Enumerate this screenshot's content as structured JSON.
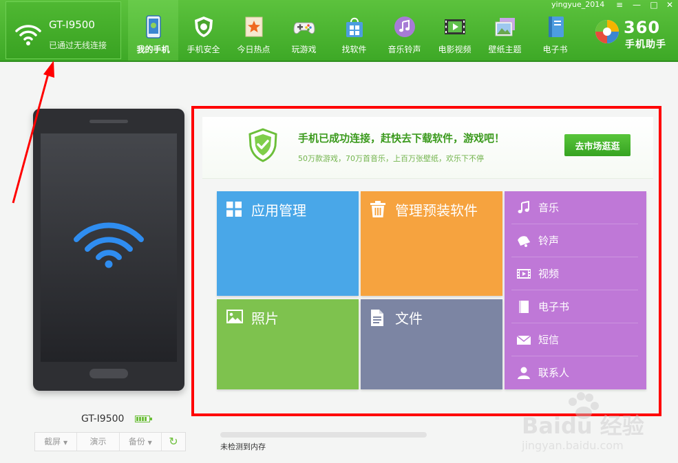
{
  "window": {
    "username": "yingyue_2014",
    "menu_glyph": "≡",
    "minimize_glyph": "—",
    "maximize_glyph": "□",
    "close_glyph": "✕"
  },
  "device_panel": {
    "name": "GT-I9500",
    "status": "已通过无线连接"
  },
  "nav": [
    {
      "label": "我的手机",
      "icon": "phone-icon",
      "active": true
    },
    {
      "label": "手机安全",
      "icon": "shield-icon",
      "active": false
    },
    {
      "label": "今日热点",
      "icon": "star-icon",
      "active": false
    },
    {
      "label": "玩游戏",
      "icon": "gamepad-icon",
      "active": false
    },
    {
      "label": "找软件",
      "icon": "shopping-bag-icon",
      "active": false
    },
    {
      "label": "音乐铃声",
      "icon": "music-icon",
      "active": false
    },
    {
      "label": "电影视频",
      "icon": "film-icon",
      "active": false
    },
    {
      "label": "壁纸主题",
      "icon": "picture-icon",
      "active": false
    },
    {
      "label": "电子书",
      "icon": "book-icon",
      "active": false
    }
  ],
  "logo": {
    "number": "360",
    "text": "手机助手"
  },
  "phone": {
    "name": "GT-I9500",
    "battery_level": 0.8
  },
  "tools": {
    "screenshot": "截屏",
    "demo": "演示",
    "backup": "备份",
    "dropdown_glyph": "▼",
    "refresh_glyph": "↻"
  },
  "banner": {
    "title": "手机已成功连接，赶快去下载软件，游戏吧！",
    "subtitle": "50万款游戏，70万首音乐，上百万张壁纸，欢乐下不停",
    "button": "去市场逛逛"
  },
  "tiles": {
    "app_management": "应用管理",
    "preinstalled": "管理预装软件",
    "photos": "照片",
    "files": "文件"
  },
  "media": [
    {
      "label": "音乐",
      "icon": "music-note-icon"
    },
    {
      "label": "铃声",
      "icon": "bell-icon"
    },
    {
      "label": "视频",
      "icon": "film-strip-icon"
    },
    {
      "label": "电子书",
      "icon": "ebook-icon"
    },
    {
      "label": "短信",
      "icon": "envelope-icon"
    },
    {
      "label": "联系人",
      "icon": "person-icon"
    }
  ],
  "memory": {
    "status": "未检测到内存",
    "progress": 0
  },
  "watermark": {
    "brand": "Baidu 经验",
    "url": "jingyan.baidu.com"
  },
  "colors": {
    "header_green": "#4ab22e",
    "tile_blue": "#49a7e8",
    "tile_orange": "#f6a33f",
    "tile_green": "#7ec24e",
    "tile_gray": "#7c85a3",
    "tile_purple": "#bf78d7",
    "annotation_red": "#ff0000"
  }
}
